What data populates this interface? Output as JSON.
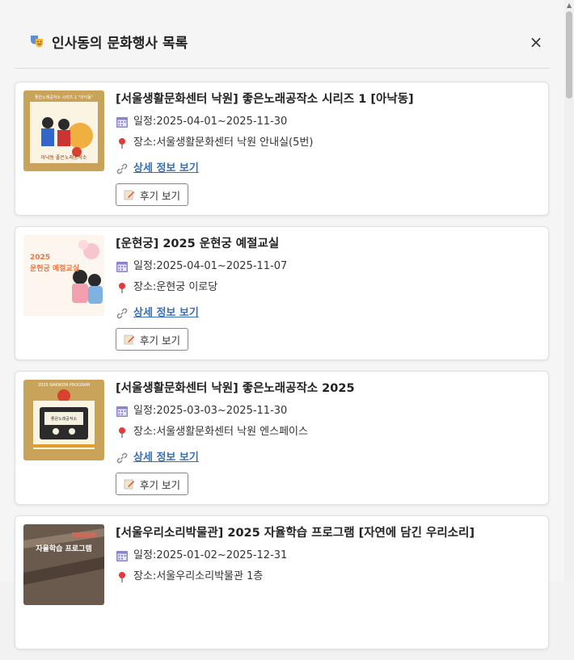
{
  "header": {
    "title": "인사동의 문화행사 목록",
    "close_label": "×"
  },
  "labels": {
    "date_prefix": "일정: ",
    "place_prefix": "장소: ",
    "detail_link": "상세 정보 보기",
    "review_button": "후기 보기"
  },
  "events": [
    {
      "title": "[서울생활문화센터 낙원] 좋은노래공작소 시리즈 1 [아낙동]",
      "date": "2025-04-01~2025-11-30",
      "place": "서울생활문화센터 낙원 안내실(5번)",
      "thumb_text": "좋은노래공작소 시리즈 1 \"아낙동\"",
      "thumb_sub": "아낙동 좋은노래공작소"
    },
    {
      "title": "[운현궁] 2025 운현궁 예절교실",
      "date": "2025-04-01~2025-11-07",
      "place": "운현궁 이로당",
      "thumb_year": "2025",
      "thumb_text": "운현궁 예절교실"
    },
    {
      "title": "[서울생활문화센터 낙원] 좋은노래공작소 2025",
      "date": "2025-03-03~2025-11-30",
      "place": "서울생활문화센터 낙원 엔스페이스",
      "thumb_text": "2025 NAKWON PROGRAM",
      "thumb_sub": "좋은노래공작소"
    },
    {
      "title": "[서울우리소리박물관] 2025 자율학습 프로그램 [자연에 담긴 우리소리]",
      "date": "2025-01-02~2025-12-31",
      "place": "서울우리소리박물관 1층",
      "thumb_text": "자율학습 프로그램"
    }
  ]
}
